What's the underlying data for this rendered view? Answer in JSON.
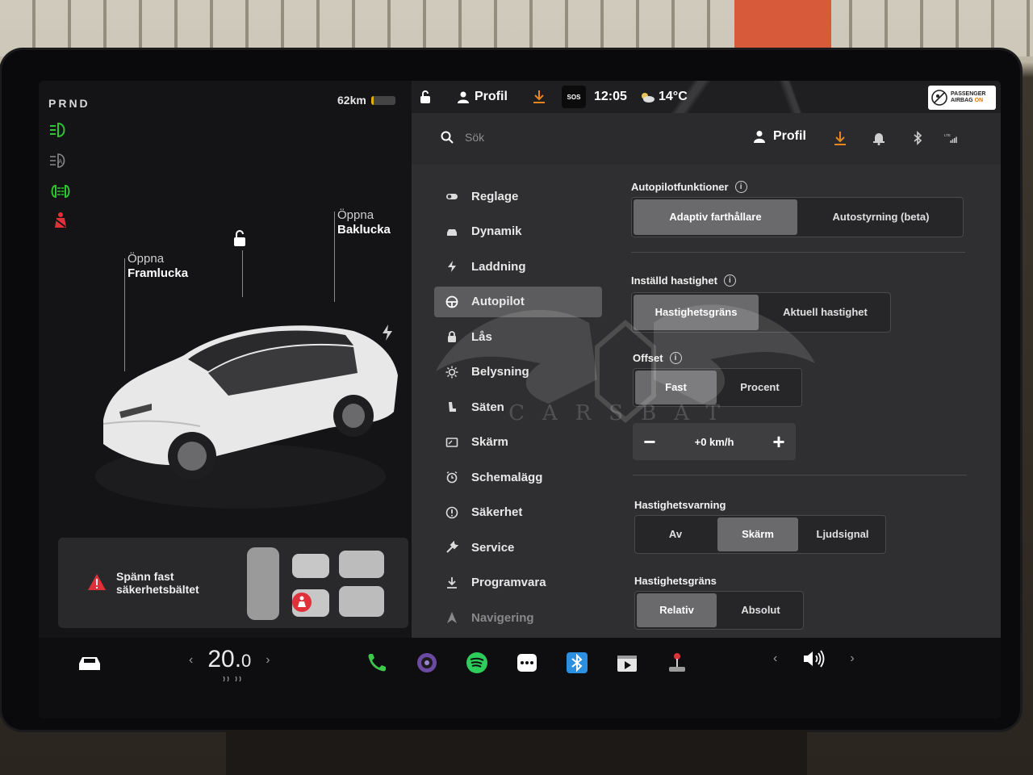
{
  "status": {
    "gear": "PRND",
    "range": "62km",
    "battery_level": 0.1,
    "profile": "Profil",
    "sos": "SOS",
    "time": "12:05",
    "temperature": "14°C",
    "airbag_line1": "PASSENGER",
    "airbag_line2": "AIRBAG",
    "airbag_state": "ON"
  },
  "car": {
    "front_trunk_action": "Öppna",
    "front_trunk_name": "Framlucka",
    "rear_trunk_action": "Öppna",
    "rear_trunk_name": "Baklucka",
    "alert_line1": "Spänn fast",
    "alert_line2": "säkerhetsbältet"
  },
  "topbar": {
    "search_placeholder": "Sök",
    "profile": "Profil"
  },
  "nav": {
    "items": [
      {
        "label": "Reglage",
        "icon": "toggle-icon"
      },
      {
        "label": "Dynamik",
        "icon": "car-icon"
      },
      {
        "label": "Laddning",
        "icon": "bolt-icon"
      },
      {
        "label": "Autopilot",
        "icon": "steering-wheel-icon",
        "active": true
      },
      {
        "label": "Lås",
        "icon": "lock-icon"
      },
      {
        "label": "Belysning",
        "icon": "sun-icon"
      },
      {
        "label": "Säten",
        "icon": "seat-icon"
      },
      {
        "label": "Skärm",
        "icon": "display-icon"
      },
      {
        "label": "Schemalägg",
        "icon": "alarm-clock-icon"
      },
      {
        "label": "Säkerhet",
        "icon": "alert-circle-icon"
      },
      {
        "label": "Service",
        "icon": "wrench-icon"
      },
      {
        "label": "Programvara",
        "icon": "download-icon"
      },
      {
        "label": "Navigering",
        "icon": "navigation-arrow-icon"
      }
    ]
  },
  "autopilot": {
    "features_title": "Autopilotfunktioner",
    "features_opt1": "Adaptiv farthållare",
    "features_opt2": "Autostyrning (beta)",
    "set_speed_title": "Inställd hastighet",
    "set_speed_opt1": "Hastighetsgräns",
    "set_speed_opt2": "Aktuell hastighet",
    "offset_title": "Offset",
    "offset_opt1": "Fast",
    "offset_opt2": "Procent",
    "offset_value": "+0 km/h",
    "minus": "−",
    "plus": "+",
    "warning_title": "Hastighetsvarning",
    "warning_opt1": "Av",
    "warning_opt2": "Skärm",
    "warning_opt3": "Ljudsignal",
    "limit_title": "Hastighetsgräns",
    "limit_opt1": "Relativ",
    "limit_opt2": "Absolut"
  },
  "watermark": "CARSBAT",
  "dock": {
    "temp_whole": "20.",
    "temp_decimal": "0",
    "chev_left": "‹",
    "chev_right": "›"
  },
  "colors": {
    "accent_orange": "#e8851c",
    "green_lights": "#31c431",
    "alert_red": "#e0313a"
  }
}
